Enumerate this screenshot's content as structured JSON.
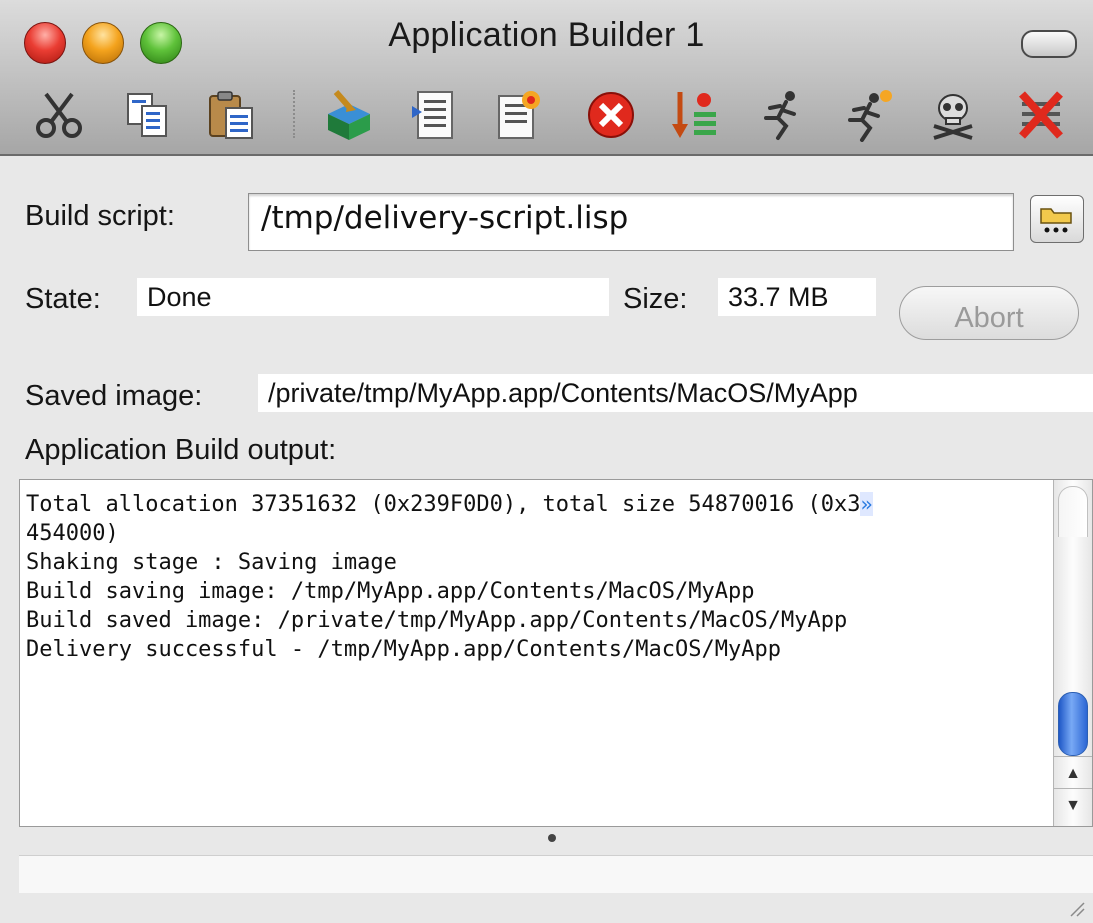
{
  "window": {
    "title": "Application Builder 1"
  },
  "toolbar": {
    "buttons": [
      {
        "icon": "scissors-icon",
        "name": "cut-button"
      },
      {
        "icon": "copy-icon",
        "name": "copy-button"
      },
      {
        "icon": "paste-icon",
        "name": "paste-button"
      },
      {
        "icon": "build-box-icon",
        "name": "build-button"
      },
      {
        "icon": "script-list-icon",
        "name": "script-button"
      },
      {
        "icon": "new-script-icon",
        "name": "new-script-button"
      },
      {
        "icon": "error-circle-icon",
        "name": "stop-button"
      },
      {
        "icon": "load-list-icon",
        "name": "load-button"
      },
      {
        "icon": "runner-icon",
        "name": "run-button"
      },
      {
        "icon": "runner-star-icon",
        "name": "run-new-button"
      },
      {
        "icon": "skull-icon",
        "name": "kill-button"
      },
      {
        "icon": "red-x-icon",
        "name": "clear-button"
      }
    ]
  },
  "form": {
    "build_script_label": "Build script:",
    "build_script_value": "/tmp/delivery-script.lisp",
    "state_label": "State:",
    "state_value": "Done",
    "size_label": "Size:",
    "size_value": "33.7 MB",
    "abort_label": "Abort",
    "saved_image_label": "Saved image:",
    "saved_image_value": "/private/tmp/MyApp.app/Contents/MacOS/MyApp",
    "output_label": "Application Build output:"
  },
  "output": {
    "lines": [
      "",
      "Total allocation 37351632 (0x239F0D0), total size 54870016 (0x3",
      "454000)",
      "",
      "",
      "",
      "Shaking stage : Saving image",
      "Build saving image: /tmp/MyApp.app/Contents/MacOS/MyApp",
      "Build saved image: /private/tmp/MyApp.app/Contents/MacOS/MyApp",
      "",
      "Delivery successful - /tmp/MyApp.app/Contents/MacOS/MyApp"
    ],
    "wrap_marker": "»"
  },
  "colors": {
    "accent_blue": "#2c66d4",
    "close_red": "#ea3d33",
    "minimize_yellow": "#f4a31d",
    "zoom_green": "#5fc23a"
  }
}
